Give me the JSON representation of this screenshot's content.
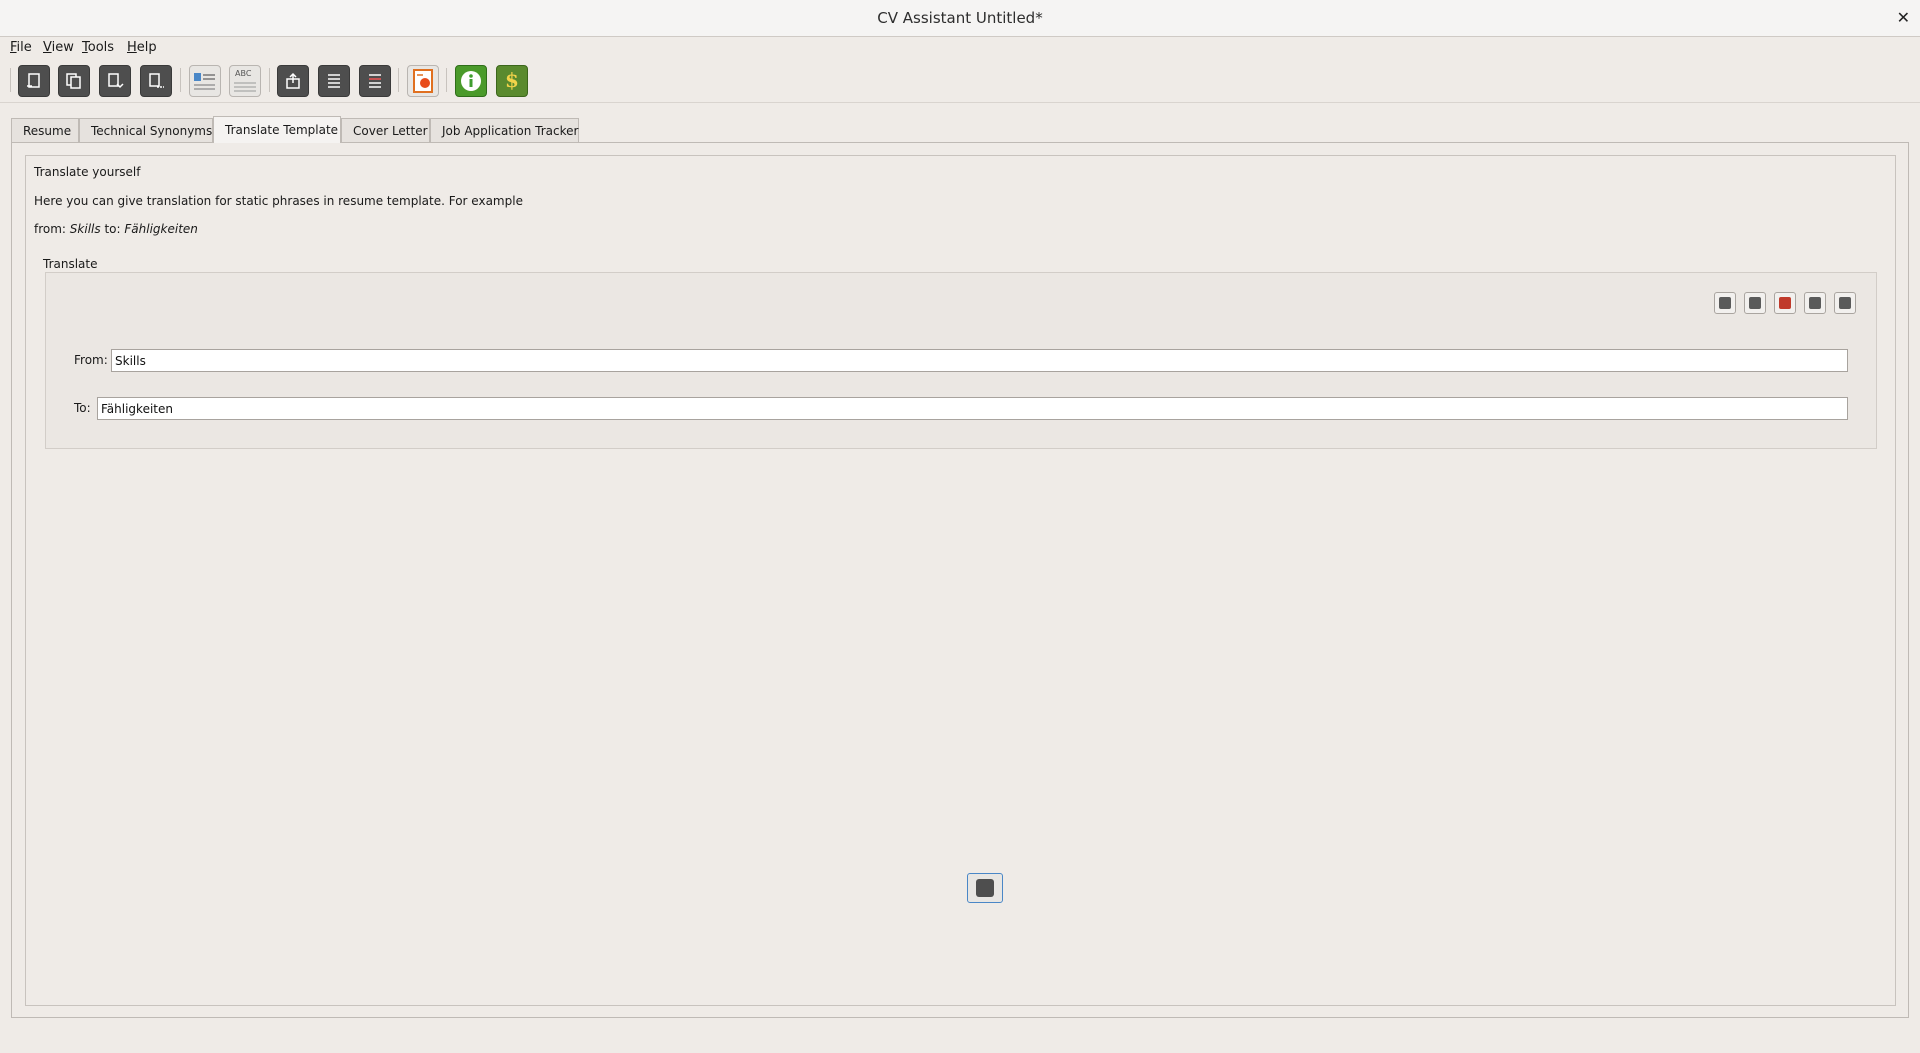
{
  "window": {
    "title": "CV Assistant Untitled*",
    "close_glyph": "✕"
  },
  "menu": [
    "File",
    "View",
    "Tools",
    "Help"
  ],
  "toolbar": {
    "buttons": [
      {
        "name": "new-document-icon"
      },
      {
        "name": "copy-document-icon"
      },
      {
        "name": "open-document-icon"
      },
      {
        "name": "save-document-icon"
      },
      {
        "name": "resume-preview-icon"
      },
      {
        "name": "spellcheck-abc-icon",
        "label": "ABC"
      },
      {
        "name": "export-icon"
      },
      {
        "name": "list-icon"
      },
      {
        "name": "list-alt-icon"
      },
      {
        "name": "presentation-icon"
      },
      {
        "name": "info-icon"
      },
      {
        "name": "donate-dollar-icon"
      }
    ]
  },
  "tabs": [
    "Resume",
    "Technical Synonyms",
    "Translate Template",
    "Cover Letter",
    "Job Application Tracker"
  ],
  "active_tab": "Translate Template",
  "content": {
    "heading": "Translate yourself",
    "description": "Here you can give translation for static phrases in resume template. For example",
    "example_from_label": "from:",
    "example_from": "Skills",
    "example_to_label": "to:",
    "example_to": "Fähligkeiten",
    "group_title": "Translate",
    "from_label": "From:",
    "from_value": "Skills",
    "to_label": "To:",
    "to_value": "Fähligkeiten"
  },
  "colors": {
    "accent": "#4a87c7",
    "delete": "#c03a2b",
    "icon_dark": "#4e4e4e",
    "info_green": "#3f9e2f"
  }
}
